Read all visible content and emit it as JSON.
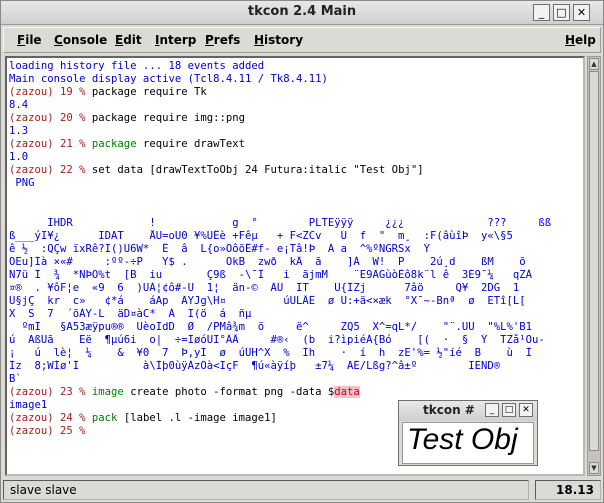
{
  "window": {
    "title": "tkcon 2.4 Main",
    "controls": {
      "minimize": "_",
      "maximize": "□",
      "close": "✕"
    }
  },
  "menubar": {
    "items": [
      {
        "label": "File"
      },
      {
        "label": "Console"
      },
      {
        "label": "Edit"
      },
      {
        "label": "Interp"
      },
      {
        "label": "Prefs"
      },
      {
        "label": "History"
      },
      {
        "label": "Help"
      }
    ]
  },
  "console": {
    "lines": [
      {
        "type": "out",
        "text": "loading history file ... 18 events added"
      },
      {
        "type": "out",
        "text": "Main console display active (Tcl8.4.11 / Tk8.4.11)"
      },
      {
        "type": "prompt",
        "prompt": "(zazou) 19 % ",
        "cmd": "package require Tk"
      },
      {
        "type": "out",
        "text": "8.4"
      },
      {
        "type": "prompt",
        "prompt": "(zazou) 20 % ",
        "cmd": "package require img::png"
      },
      {
        "type": "out",
        "text": "1.3"
      },
      {
        "type": "prompt",
        "prompt": "(zazou) 21 % ",
        "kw": "package",
        "cmd": " require drawText"
      },
      {
        "type": "out",
        "text": "1.0"
      },
      {
        "type": "prompt",
        "prompt": "(zazou) 22 % ",
        "cmd": "set data [drawTextToObj 24 Futura:italic \"Test Obj\"]"
      },
      {
        "type": "out",
        "text": " PNG"
      },
      {
        "type": "out",
        "text": ""
      },
      {
        "type": "out",
        "text": ""
      },
      {
        "type": "out",
        "text": "      IHDR            !            g  °        PLTEÿÿÿ     ¿¿¿             ???     ßß"
      },
      {
        "type": "out",
        "text": "ß___ýI¥¿      IDAT    ÅU=oÜ0 ¥%ÜÊè +Fêµ   + F<ZCv   Ú  f  \"  m¸  :F(âùîÞ  y«\\§5"
      },
      {
        "type": "out",
        "text": "ê ½  :QÇw ïxRê?I()Ú6W*  Ê  â  L{o»ÖôõÊ#f- e¡Tâ!Þ  A a  ^%ºÑGRSx  Ý"
      },
      {
        "type": "out",
        "text": "OEu]Ïà ×«#     :ºº-÷P   Y$ .      ÕkB  zwð  kÂ  ã    ]À  W!  P    2ú¸d    ßM    õ"
      },
      {
        "type": "out",
        "text": "Ñ7ü Ï  ¾  *NÞÕ%t  [B  iu       Ç9ß  -\\¯Ï   i  ãjmM    ¨E9ÄGùòÉô8k¨l ê  3É9¯¼   qZÀ"
      },
      {
        "type": "out",
        "text": "¤®  . ¥ôF¦e  «9  6  )UÀ¦¢ô#-U  1¦  än-©  ÄÜ  ÏT    Ü{ÏZj      7âö     Q¥  2DG  1"
      },
      {
        "type": "out",
        "text": "Ü§jÇ  kr  c»   ¢*á    áAp  ÄYJg\\H¤         úÙLÂË  ø U:+ä<×æk  °X¯~-Bnª  ø  ETî[L["
      },
      {
        "type": "out",
        "text": "X  S  7  ´õÀY-L  äD¤àC*  Á  I(ö  á  ñµ"
      },
      {
        "type": "out",
        "text": "  ºmÏ   §Ã53æÿpu®®  UèoIdD  Ø  /PMâ¾m  õ     ë^     ZQ5  X^=qL*/    \"¨.UU  \"%L%'B1"
      },
      {
        "type": "out",
        "text": "ú  ÃßÜã    Ëë  ¶µú6i  o|  ÷=IøóUI°ÂÂ     #®‹  (b  i?ìpiéÁ{Bó    [(  ·  §  Ý  TZå¹Ou-"
      },
      {
        "type": "out",
        "text": "¡   ú  lè¦  ¼    &  ¥0  7  Þ,yÏ  ø  úÛH^X  %  Ìh    ·  í  h  zE'%= ½\"íé  B    ù  Ì"
      },
      {
        "type": "out",
        "text": "Íz  8;WÍø'Í          à\\Ìþ0ùÿÀzÖà<IçF  ¶ú«àÿíþ   ±7¼  ÄÉ/Lßg?^â±º        IEND®"
      },
      {
        "type": "out",
        "text": "B`"
      },
      {
        "type": "prompt",
        "prompt": "(zazou) 23 % ",
        "kw": "image",
        "cmd": " create photo -format png -data $",
        "hl": "data"
      },
      {
        "type": "out",
        "text": "image1"
      },
      {
        "type": "prompt",
        "prompt": "(zazou) 24 % ",
        "kw": "pack",
        "cmd": " [label .l -image image1]"
      },
      {
        "type": "prompt",
        "prompt": "(zazou) 25 % ",
        "cmd": ""
      }
    ]
  },
  "statusbar": {
    "left": "slave slave",
    "right": "18.13"
  },
  "photo_window": {
    "title": "tkcon #",
    "controls": {
      "minimize": "_",
      "maximize": "□",
      "close": "✕"
    },
    "image_text": "Test Obj"
  }
}
